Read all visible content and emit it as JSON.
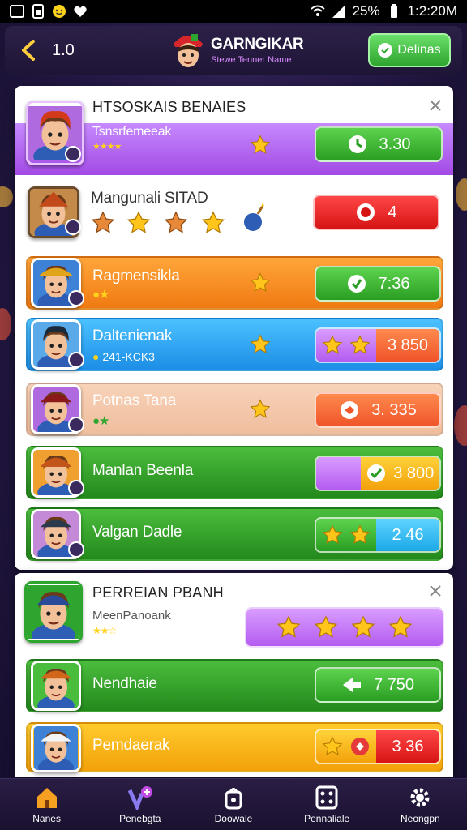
{
  "status_bar": {
    "time": "1:2:20M",
    "battery": "25%"
  },
  "header": {
    "level": "1.0",
    "logo_title": "GARNGIKAR",
    "logo_subtitle": "Stewe Tenner Name",
    "button_label": "Delinas"
  },
  "panel1": {
    "title": "HTSOSKAIS BENAIES",
    "rows": [
      {
        "name": "Tsnsrfemeeak",
        "action": "3.30"
      },
      {
        "name": "Mangunali SITAD",
        "action": "4"
      },
      {
        "name": "Ragmensikla",
        "action": "7:36"
      },
      {
        "name": "Daltenienak",
        "sub": "241-KCK3",
        "action": "3  850"
      },
      {
        "name": "Potnas Tana",
        "action": "3. 335"
      },
      {
        "name": "Manlan Beenla",
        "action": "3  800"
      },
      {
        "name": "Valgan Dadle",
        "action": "2  46"
      }
    ]
  },
  "panel2": {
    "title": "PERREIAN PBANH",
    "rows": [
      {
        "name": "MeenPanoank"
      },
      {
        "name": "Nendhaie",
        "action": "7  750"
      },
      {
        "name": "Pemdaerak",
        "action": "3  36"
      }
    ]
  },
  "nav": [
    {
      "label": "Nanes"
    },
    {
      "label": "Penebgta"
    },
    {
      "label": "Doowale"
    },
    {
      "label": "Pennaliale"
    },
    {
      "label": "Neongpn"
    }
  ],
  "colors": {
    "accent_green": "#2ea52e",
    "accent_purple": "#a24ae4",
    "accent_red": "#d61414",
    "accent_blue": "#1c8ee6",
    "accent_orange": "#f07a12",
    "star_gold": "#ffc51a"
  }
}
